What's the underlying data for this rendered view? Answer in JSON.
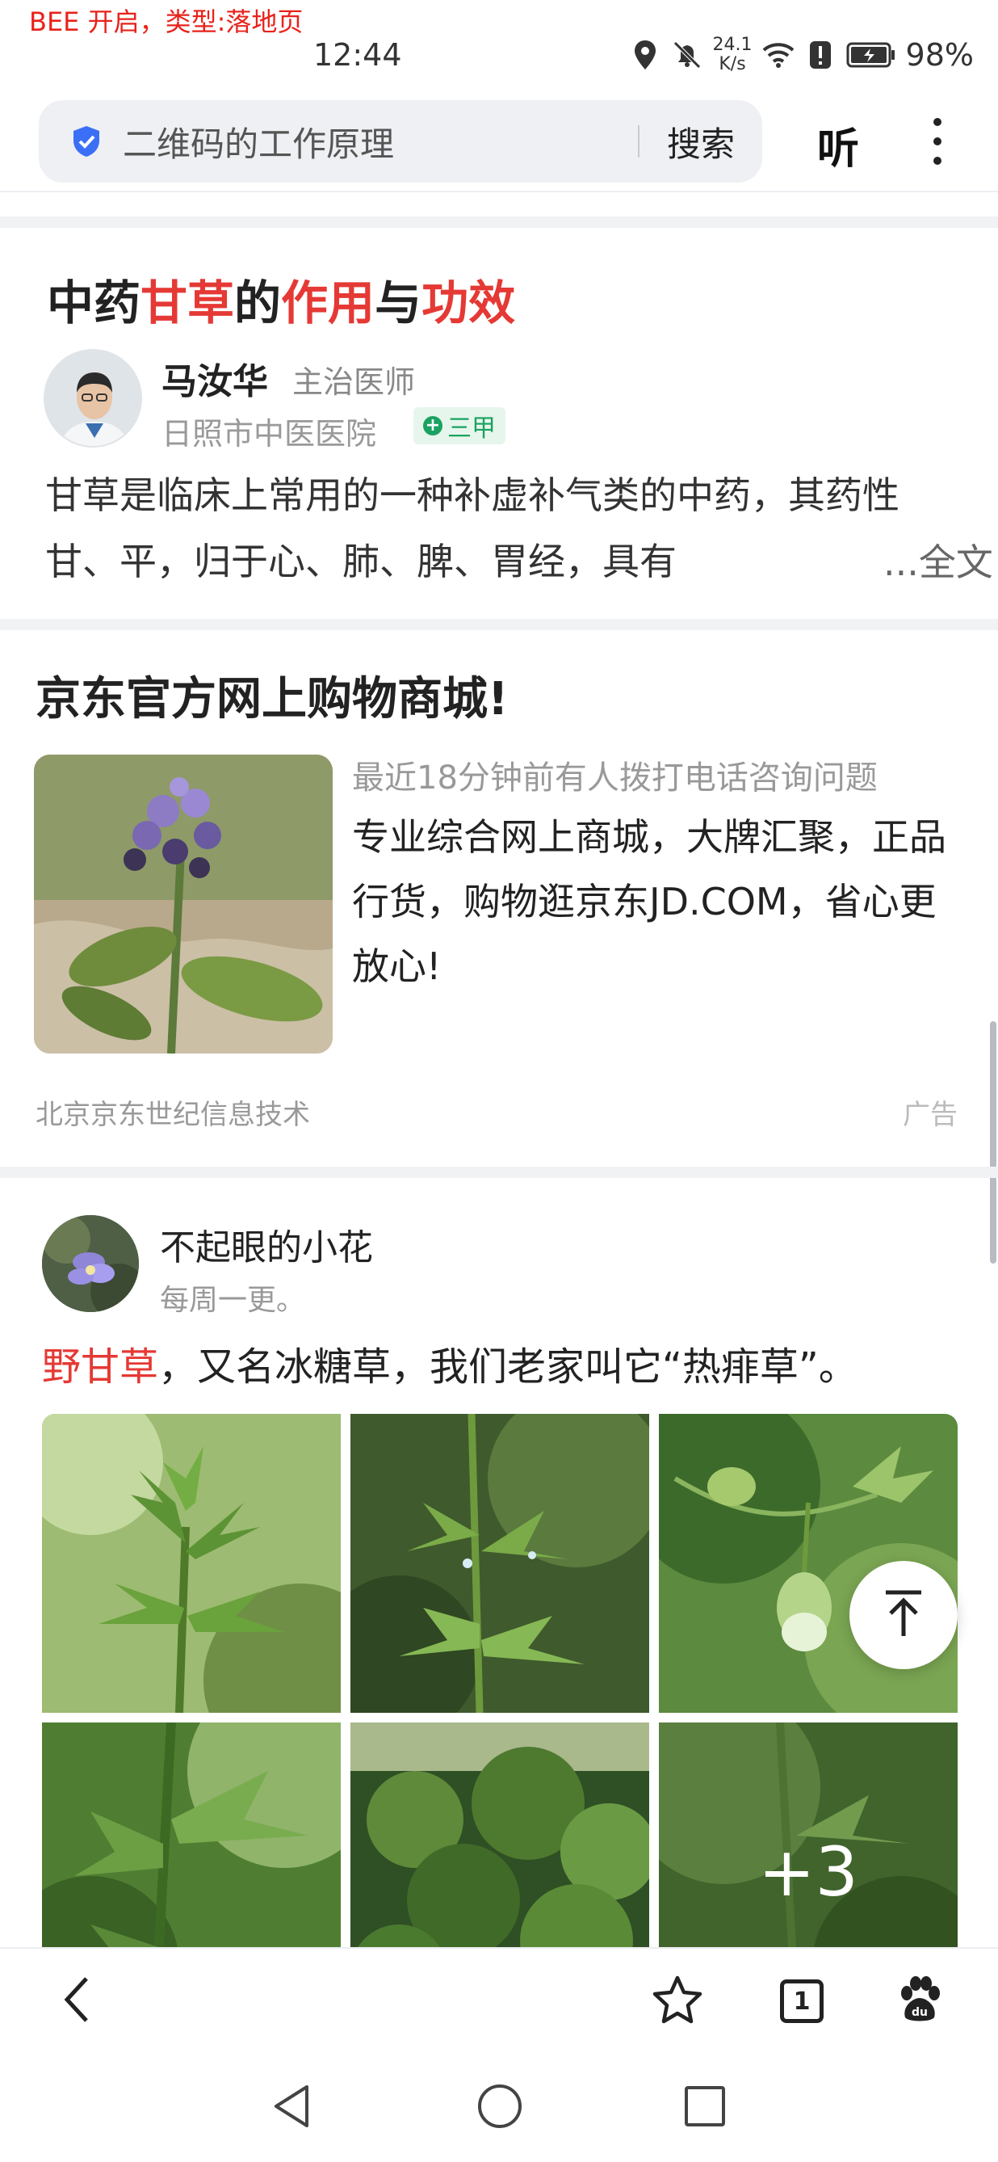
{
  "debug_banner": "BEE 开启，类型:落地页",
  "status_bar": {
    "time": "12:44",
    "network_speed_value": "24.1",
    "network_speed_unit": "K/s",
    "battery": "98%"
  },
  "search": {
    "query": "二维码的工作原理",
    "search_button": "搜索",
    "listen_button": "听"
  },
  "card_doctor": {
    "title_parts": [
      "中药",
      "甘草",
      "的",
      "作用",
      "与",
      "功效"
    ],
    "doctor_name": "马汝华",
    "doctor_title": "主治医师",
    "hospital": "日照市中医医院",
    "hospital_grade": "三甲",
    "body": "甘草是临床上常用的一种补虚补气类的中药，其药性甘、平，归于心、肺、脾、胃经，具有",
    "read_more": "...全文"
  },
  "card_ad": {
    "title": "京东官方网上购物商城!",
    "meta": "最近18分钟前有人拨打电话咨询问题",
    "description": "专业综合网上商城，大牌汇聚，正品行货，购物逛京东JD.COM，省心更放心!",
    "source": "北京京东世纪信息技术",
    "ad_label": "广告"
  },
  "card_post": {
    "author_name": "不起眼的小花",
    "author_subtitle": "每周一更。",
    "text_highlight": "野甘草",
    "text_rest": "，又名冰糖草，我们老家叫它“热痱草”。",
    "more_images": "+3"
  },
  "toolbar": {
    "tab_count": "1"
  },
  "icons": {
    "back": "chevron-left-icon",
    "favorite": "star-icon",
    "tabs": "tab-count-icon",
    "home": "baidu-paw-icon",
    "to_top": "arrow-up-to-top-icon",
    "nav_back": "triangle-back-icon",
    "nav_home": "circle-home-icon",
    "nav_recent": "square-recent-icon"
  },
  "colors": {
    "highlight_red": "#e53935",
    "badge_green": "#1aa260",
    "search_bg": "#eef0f3",
    "shield_blue": "#3b6ff5"
  }
}
